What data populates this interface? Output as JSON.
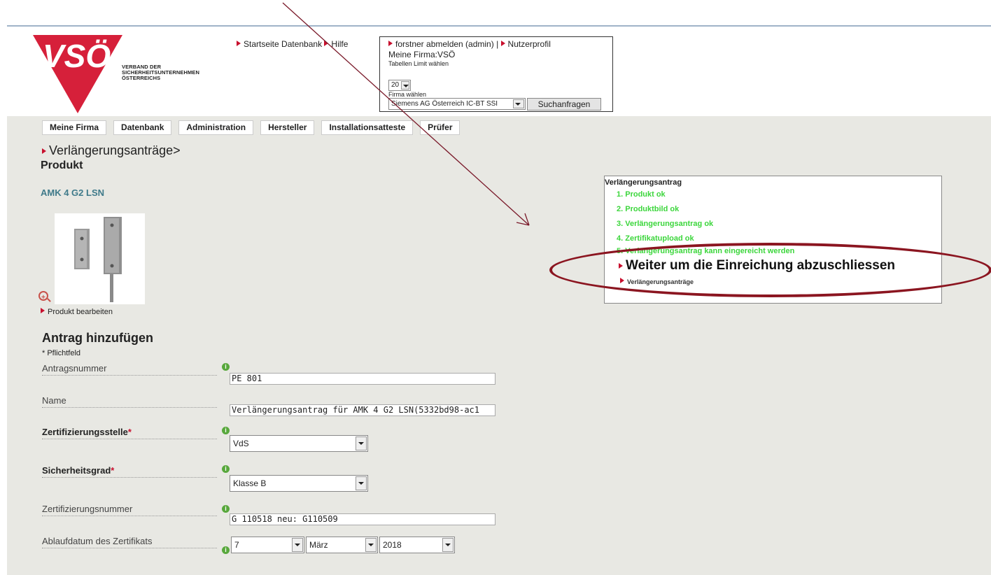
{
  "logo": {
    "letters": "VSÖ",
    "text_lines": [
      "VERBAND DER",
      "SICHERHEITSUNTERNEHMEN",
      "ÖSTERREICHS"
    ]
  },
  "top_links": {
    "startseite": "Startseite Datenbank",
    "hilfe": "Hilfe"
  },
  "user_box": {
    "logout": "forstner abmelden (admin) |",
    "profile": "Nutzerprofil",
    "my_company": "Meine Firma:VSÖ",
    "limit_label": "Tabellen Limit wählen",
    "limit_value": "20",
    "company_label": "Firma wählen",
    "company_value": "Siemens AG Österreich IC-BT SSI",
    "search_button": "Suchanfragen"
  },
  "nav": {
    "tabs": [
      {
        "label": "Meine Firma"
      },
      {
        "label": "Datenbank"
      },
      {
        "label": "Administration"
      },
      {
        "label": "Hersteller"
      },
      {
        "label": "Installationsatteste"
      },
      {
        "label": "Prüfer"
      }
    ]
  },
  "breadcrumb": "Verlängerungsanträge>",
  "section_title": "Produkt",
  "product": {
    "name": "AMK 4 G2 LSN",
    "edit_link": "Produkt bearbeiten"
  },
  "form": {
    "title": "Antrag hinzufügen",
    "required_note": "* Pflichtfeld",
    "fields": {
      "antragsnummer": {
        "label": "Antragsnummer",
        "value": "PE 801"
      },
      "name": {
        "label": "Name",
        "value": "Verlängerungsantrag für AMK 4 G2 LSN(5332bd98-ac1"
      },
      "zertifizierungsstelle": {
        "label": "Zertifizierungsstelle",
        "value": "VdS"
      },
      "sicherheitsgrad": {
        "label": "Sicherheitsgrad",
        "value": "Klasse B"
      },
      "zertifizierungsnummer": {
        "label": "Zertifizierungsnummer",
        "value": "G 110518 neu: G110509"
      },
      "ablaufdatum": {
        "label": "Ablaufdatum des Zertifikats",
        "day": "7",
        "month": "März",
        "year": "2018"
      }
    },
    "required_marker": "*"
  },
  "inset": {
    "title": "Verlängerungsantrag",
    "steps": [
      "1. Produkt ok",
      "2. Produktbild ok",
      "3. Verlängerungsantrag ok",
      "4. Zertifikatupload ok",
      "5. Verlängerungsantrag kann eingereicht werden"
    ],
    "cta": "Weiter um die Einreichung abzuschliessen",
    "sub": "Verlängerungsanträge"
  },
  "colors": {
    "accent_red": "#c8102e",
    "step_green": "#3cd63c",
    "annotation": "#8b1520"
  }
}
